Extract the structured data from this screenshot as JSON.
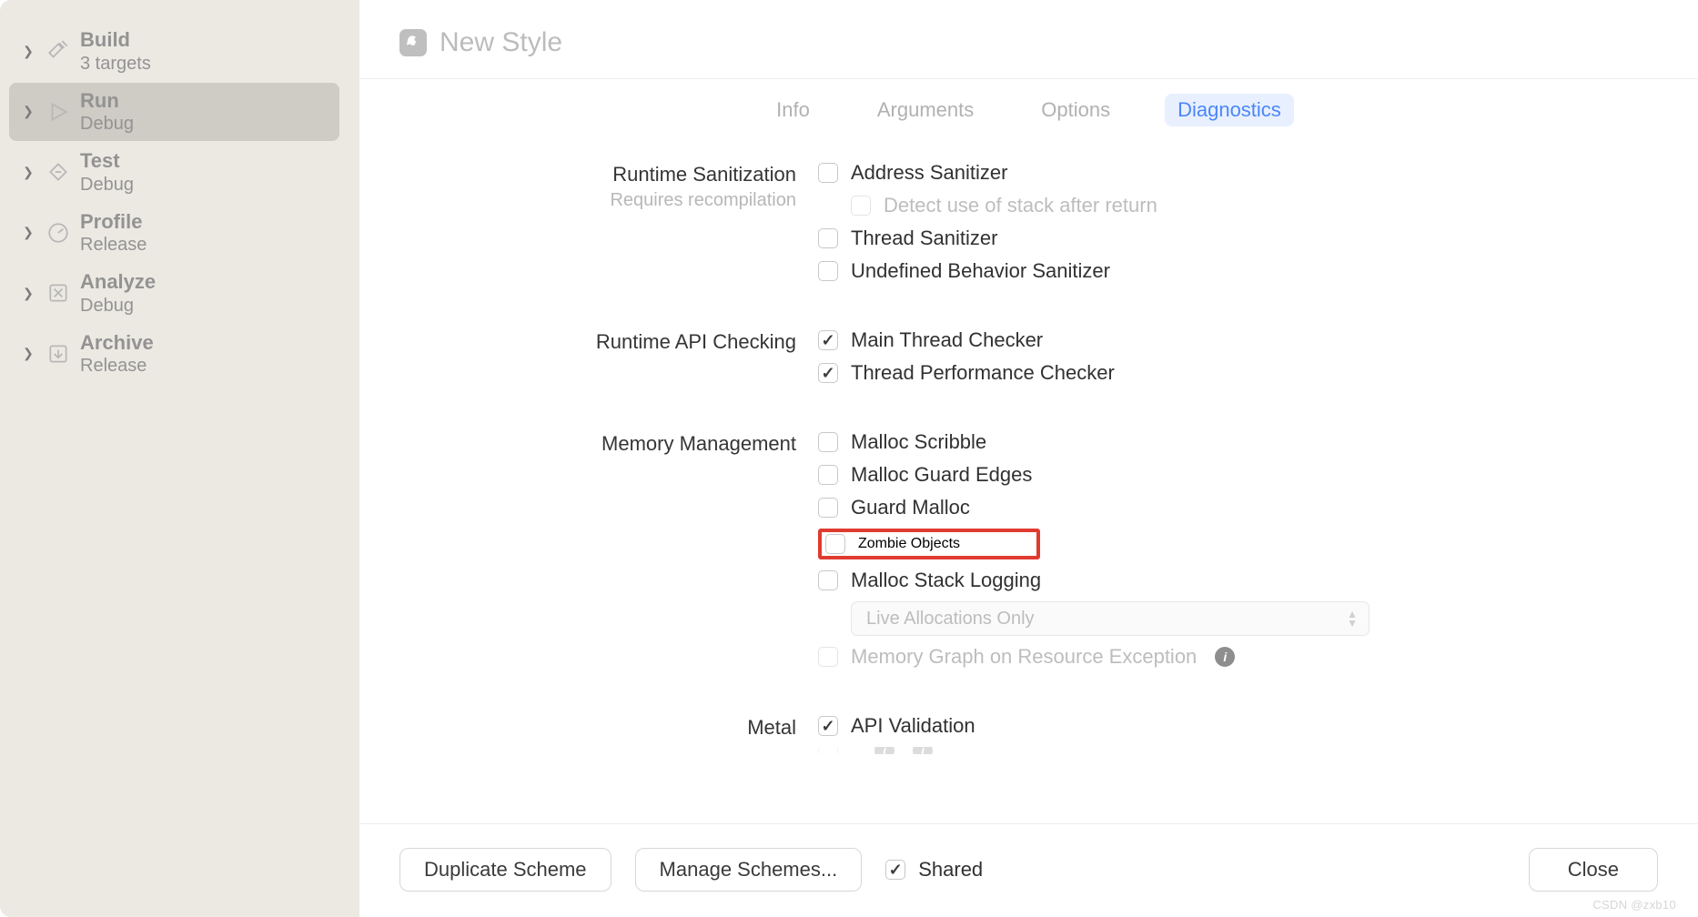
{
  "sidebar": {
    "items": [
      {
        "title": "Build",
        "sub": "3 targets"
      },
      {
        "title": "Run",
        "sub": "Debug"
      },
      {
        "title": "Test",
        "sub": "Debug"
      },
      {
        "title": "Profile",
        "sub": "Release"
      },
      {
        "title": "Analyze",
        "sub": "Debug"
      },
      {
        "title": "Archive",
        "sub": "Release"
      }
    ]
  },
  "header": {
    "title": "New Style"
  },
  "tabs": {
    "info": "Info",
    "arguments": "Arguments",
    "options": "Options",
    "diagnostics": "Diagnostics"
  },
  "sections": {
    "runtime_sanitization": {
      "label": "Runtime Sanitization",
      "sub": "Requires recompilation",
      "address": "Address Sanitizer",
      "detect_stack": "Detect use of stack after return",
      "thread": "Thread Sanitizer",
      "ub": "Undefined Behavior Sanitizer"
    },
    "api_checking": {
      "label": "Runtime API Checking",
      "main_thread": "Main Thread Checker",
      "thread_perf": "Thread Performance Checker"
    },
    "memory": {
      "label": "Memory Management",
      "scribble": "Malloc Scribble",
      "guard_edges": "Malloc Guard Edges",
      "guard_malloc": "Guard Malloc",
      "zombie": "Zombie Objects",
      "stack_logging": "Malloc Stack Logging",
      "select_value": "Live Allocations Only",
      "mem_graph": "Memory Graph on Resource Exception"
    },
    "metal": {
      "label": "Metal",
      "api_validation": "API Validation"
    }
  },
  "footer": {
    "duplicate": "Duplicate Scheme",
    "manage": "Manage Schemes...",
    "shared": "Shared",
    "close": "Close"
  },
  "watermark": "CSDN @zxb10"
}
